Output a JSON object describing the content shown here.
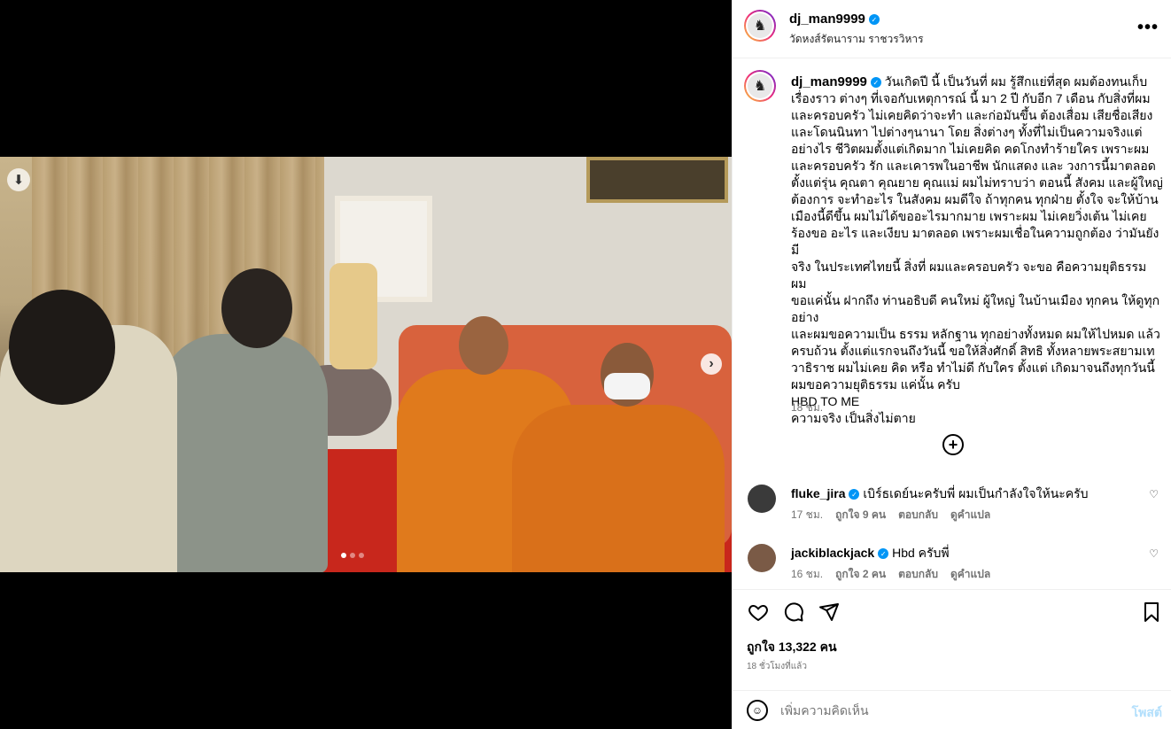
{
  "post": {
    "username": "dj_man9999",
    "location": "วัดหงส์รัตนาราม ราชวรวิหาร",
    "more_label": "•••"
  },
  "media": {
    "download_icon": "download-arrow-icon",
    "next_icon": "chevron-right-icon",
    "next_glyph": "›",
    "download_glyph": "⬇",
    "slide_count": 3,
    "active_slide": 1
  },
  "caption": {
    "username": "dj_man9999",
    "text": "วันเกิดปี นี้ เป็นวันที่ ผม รู้สึกแย่ที่สุด ผมต้องทนเก็บ\nเรื่องราว ต่างๆ ที่เจอกับเหตุการณ์ นี้ มา 2 ปี กับอีก 7 เดือน กับสิ่งที่ผม\nและครอบครัว ไม่เคยคิดว่าจะทำ และก่อมันขึ้น ต้องเสื่อม เสียชื่อเสียง\nและโดนนินทา ไปต่างๆนานา โดย สิ่งต่างๆ ทั้งที่ไม่เป็นความจริงแต่\nอย่างไร ชีวิตผมตั้งแต่เกิดมาก ไม่เคยคิด คดโกงทำร้ายใคร เพราะผม\nและครอบครัว รัก และเคารพในอาชีพ นักแสดง และ วงการนี้มาตลอด\nตั้งแต่รุ่น คุณตา คุณยาย คุณแม่ ผมไม่ทราบว่า ตอนนี้ สังคม และผู้ใหญ่\nต้องการ จะทำอะไร ในสังคม ผมดีใจ ถ้าทุกคน ทุกฝ่าย ตั้งใจ จะให้บ้าน\nเมืองนี้ดีขึ้น ผมไม่ได้ขออะไรมากมาย เพราะผม ไม่เคยวิ่งเต้น ไม่เคย\nร้องขอ อะไร และเงียบ มาตลอด เพราะผมเชื่อในความถูกต้อง ว่ามันยังมี\nจริง ในประเทศไทยนี้ สิ่งที่ ผมและครอบครัว จะขอ คือความยุติธรรม ผม\nขอแค่นั้น ฝากถึง ท่านอธิบดี คนใหม่ ผู้ใหญ่ ในบ้านเมือง ทุกคน ให้ดูทุก\nอย่าง\nและผมขอความเป็น ธรรม หลักฐาน ทุกอย่างทั้งหมด ผมให้ไปหมด แล้ว\nครบถ้วน ตั้งแต่แรกจนถึงวันนี้ ขอให้สิ่งศักดิ์ สิทธิ ทั้งหลายพระสยามเท\nวาธิราช ผมไม่เคย คิด หรือ ทำไม่ดี กับใคร ตั้งแต่ เกิดมาจนถึงทุกวันนี้\nผมขอความยุติธรรม แค่นั้น ครับ\nHBD TO ME\nความจริง เป็นสิ่งไม่ตาย",
    "time": "18 ชม."
  },
  "load_more_icon": "plus-circle-icon",
  "comments": [
    {
      "username": "fluke_jira",
      "text": "เบิร์ธเดย์นะครับพี่ ผมเป็นกำลังใจให้นะครับ",
      "time": "17 ชม.",
      "likes": "ถูกใจ 9 คน",
      "reply": "ตอบกลับ",
      "translate": "ดูคำแปล",
      "avatar_color": "#3a3a3a"
    },
    {
      "username": "jackiblackjack",
      "text": "Hbd ครับพี่",
      "time": "16 ชม.",
      "likes": "ถูกใจ 2 คน",
      "reply": "ตอบกลับ",
      "translate": "ดูคำแปล",
      "avatar_color": "#7a5a46"
    }
  ],
  "actions": {
    "like_icon": "heart-icon",
    "comment_icon": "comment-icon",
    "share_icon": "send-icon",
    "save_icon": "bookmark-icon",
    "likes_text": "ถูกใจ 13,322 คน",
    "post_time": "18 ชั่วโมงที่แล้ว"
  },
  "add_comment": {
    "placeholder": "เพิ่มความคิดเห็น",
    "post_label": "โพสต์",
    "emoji_icon": "emoji-icon"
  },
  "colors": {
    "verified": "#0095f6",
    "post_button_disabled": "#b2dffc"
  }
}
